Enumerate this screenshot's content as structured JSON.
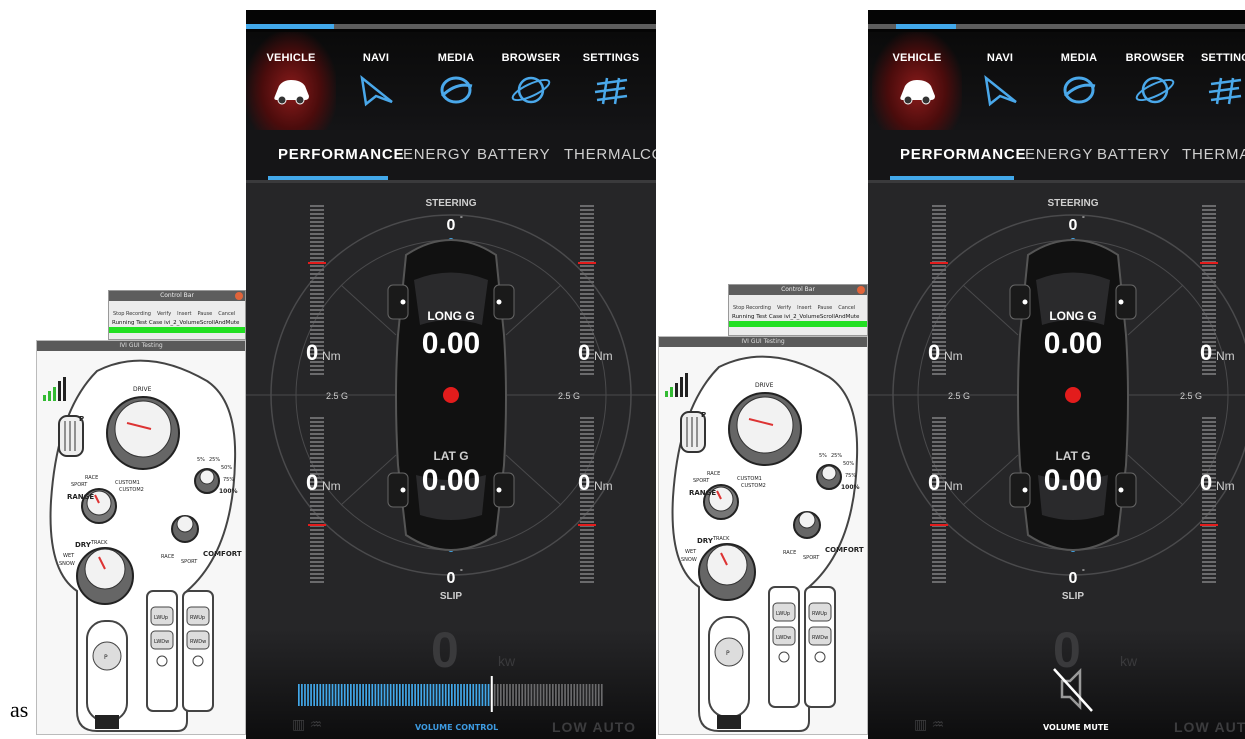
{
  "caption": "as",
  "control_bar": {
    "title": "Control Bar",
    "buttons": [
      "Stop Recording",
      "Verify",
      "Insert",
      "Pause",
      "Cancel"
    ],
    "status": "Running Test Case ivi_2_VolumeScrollAndMute"
  },
  "console": {
    "title": "IVI GUI Testing",
    "drive": "DRIVE",
    "p_label": "P",
    "range_label": "RANGE",
    "dry_label": "DRY",
    "wet_label": "WET",
    "snow_label": "SNOW",
    "track_label": "TRACK",
    "race_label": "RACE",
    "sport_label": "SPORT",
    "custom1_label": "CUSTOM1",
    "custom2_label": "CUSTOM2",
    "comfort_label": "COMFORT",
    "race2_label": "RACE",
    "sport2_label": "SPORT",
    "pct_5": "5%",
    "pct_25": "25%",
    "pct_50": "50%",
    "pct_75": "75%",
    "pct_100": "100%",
    "lw_up": "LWUp",
    "rw_up": "RWUp",
    "lw_dw": "LWDw",
    "rw_dw": "RWDw",
    "park": "P"
  },
  "nav": [
    "VEHICLE",
    "NAVI",
    "MEDIA",
    "BROWSER",
    "SETTINGS"
  ],
  "subtabs": [
    "PERFORMANCE",
    "ENERGY",
    "BATTERY",
    "THERMAL",
    "CO"
  ],
  "subtabs_b": [
    "PERFORMANCE",
    "ENERGY",
    "BATTERY",
    "THERMAL"
  ],
  "gauge": {
    "steering_label": "STEERING",
    "steering_value": "0",
    "steering_unit": "°",
    "long_g_label": "LONG G",
    "long_g_value": "0.00",
    "lat_g_label": "LAT G",
    "lat_g_value": "0.00",
    "slip_label": "SLIP",
    "slip_value": "0",
    "slip_unit": "°",
    "g_scale_left": "2.5 G",
    "g_scale_right": "2.5 G",
    "torque_value": "0",
    "torque_unit": "Nm"
  },
  "power": {
    "value": "0",
    "unit": "kw"
  },
  "screen_a": {
    "volume_label": "VOLUME CONTROL",
    "volume_level": 0.63
  },
  "screen_b": {
    "volume_label": "VOLUME MUTE"
  },
  "climate": {
    "mode": "LOW",
    "auto": "AUTO"
  },
  "colors": {
    "accent": "#42a8ea",
    "active_nav": "#8b1b1b",
    "indicator": "#e31c1c",
    "status_green": "#22e022"
  }
}
